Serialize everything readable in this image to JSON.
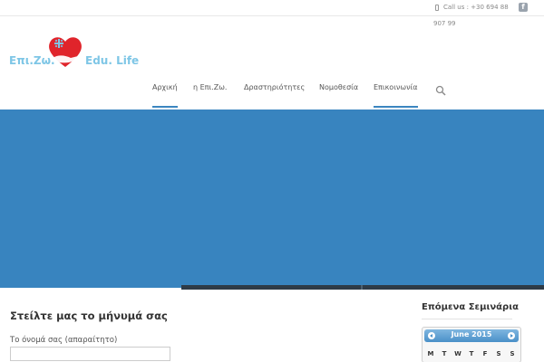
{
  "topbar": {
    "phone_line1": "Call us : +30 694 88",
    "phone_line2": "907 99",
    "phone_icon": "mobile-phone-icon",
    "social_icon": "facebook-icon",
    "social_glyph": "f"
  },
  "logo": {
    "text_left": "Επι.Ζω.",
    "text_right": "Edu. Life",
    "heart_color": "#e0242b",
    "text_color": "#7ec6e6"
  },
  "nav": {
    "items": [
      {
        "label": "Αρχική",
        "active": true
      },
      {
        "label": "η Επι.Ζω.",
        "active": false
      },
      {
        "label": "Δραστηριότητες",
        "active": false
      },
      {
        "label": "Νομοθεσία",
        "active": false
      },
      {
        "label": "Επικοινωνία",
        "active": true
      }
    ],
    "search_icon": "search-icon",
    "accent_color": "#3b86c0"
  },
  "hero": {
    "background_color": "#3884bf"
  },
  "contact": {
    "title": "Στείλτε μας το μήνυμά σας",
    "name_label": "Το όνομά σας (απαραίτητο)",
    "name_value": ""
  },
  "sidebar": {
    "title": "Επόμενα Σεμινάρια",
    "calendar": {
      "month": "June 2015",
      "weekdays": [
        "M",
        "T",
        "W",
        "T",
        "F",
        "S",
        "S"
      ]
    }
  }
}
